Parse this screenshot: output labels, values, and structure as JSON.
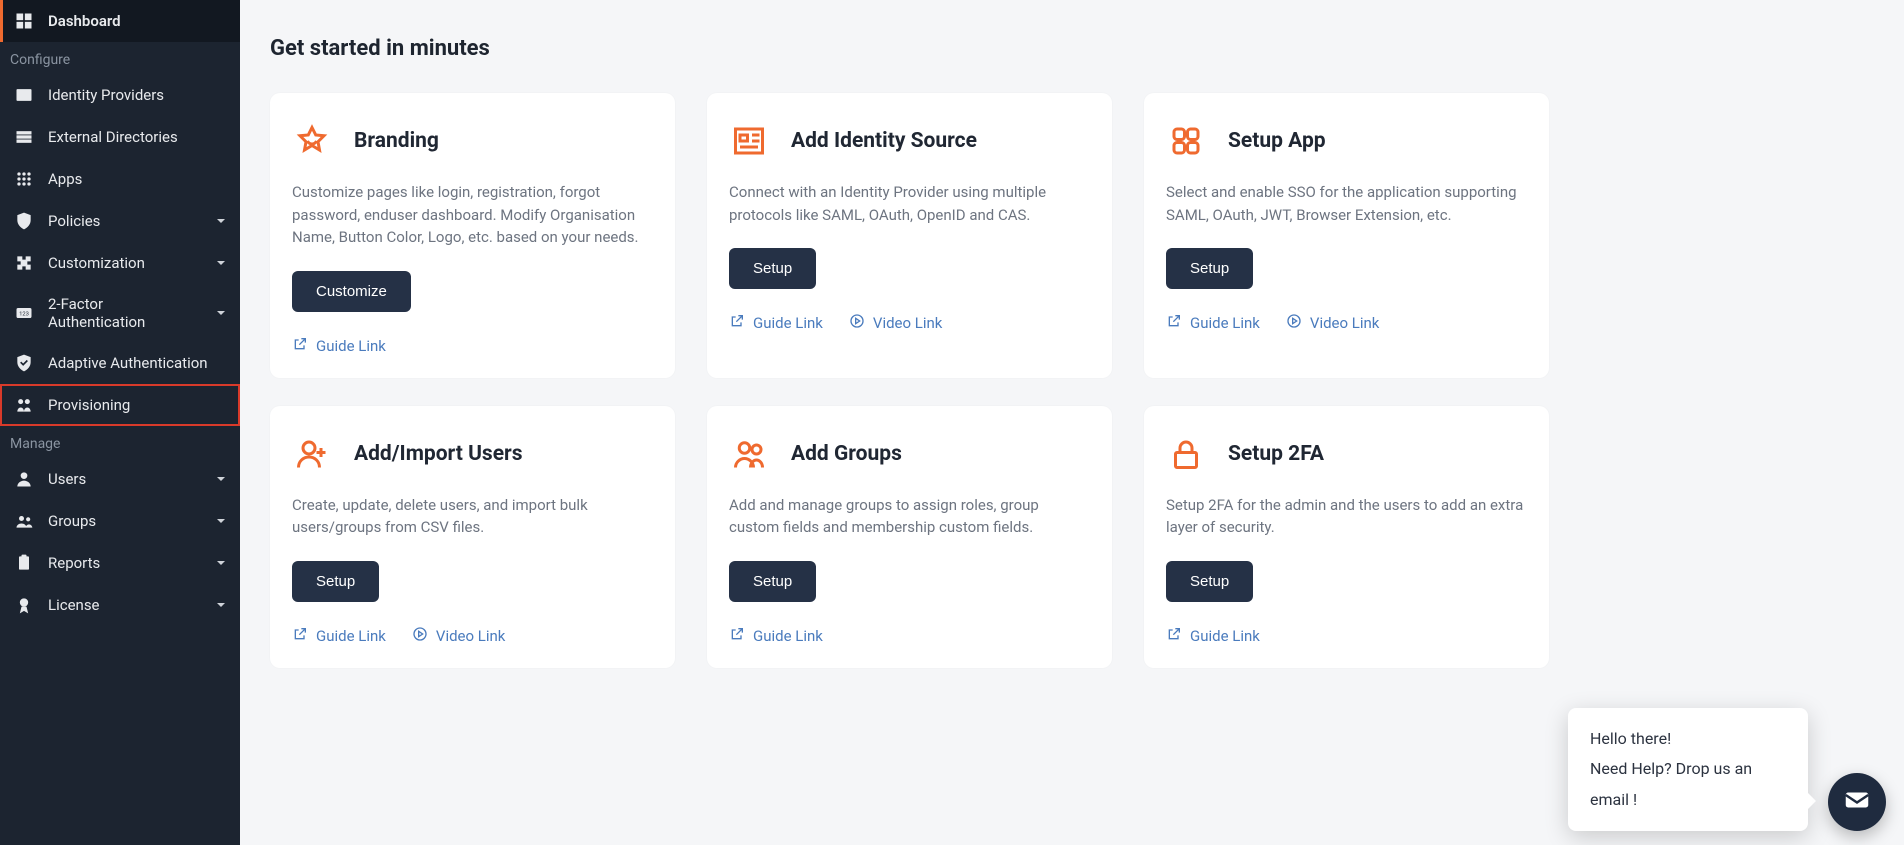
{
  "sidebar": {
    "items": [
      {
        "label": "Dashboard"
      },
      {
        "section": "Configure"
      },
      {
        "label": "Identity Providers"
      },
      {
        "label": "External Directories"
      },
      {
        "label": "Apps"
      },
      {
        "label": "Policies"
      },
      {
        "label": "Customization"
      },
      {
        "label": "2-Factor Authentication"
      },
      {
        "label": "Adaptive Authentication"
      },
      {
        "label": "Provisioning"
      },
      {
        "section": "Manage"
      },
      {
        "label": "Users"
      },
      {
        "label": "Groups"
      },
      {
        "label": "Reports"
      },
      {
        "label": "License"
      }
    ]
  },
  "page": {
    "title": "Get started in minutes"
  },
  "cards": [
    {
      "title": "Branding",
      "desc": "Customize pages like login, registration, forgot password, enduser dashboard. Modify Organisation Name, Button Color, Logo, etc. based on your needs.",
      "button": "Customize",
      "links": [
        {
          "kind": "guide",
          "label": "Guide Link"
        }
      ]
    },
    {
      "title": "Add Identity Source",
      "desc": "Connect with an Identity Provider using multiple protocols like SAML, OAuth, OpenID and CAS.",
      "button": "Setup",
      "links": [
        {
          "kind": "guide",
          "label": "Guide Link"
        },
        {
          "kind": "video",
          "label": "Video Link"
        }
      ]
    },
    {
      "title": "Setup App",
      "desc": "Select and enable SSO for the application supporting SAML, OAuth, JWT, Browser Extension, etc.",
      "button": "Setup",
      "links": [
        {
          "kind": "guide",
          "label": "Guide Link"
        },
        {
          "kind": "video",
          "label": "Video Link"
        }
      ]
    },
    {
      "title": "Add/Import Users",
      "desc": "Create, update, delete users, and import bulk users/groups from CSV files.",
      "button": "Setup",
      "links": [
        {
          "kind": "guide",
          "label": "Guide Link"
        },
        {
          "kind": "video",
          "label": "Video Link"
        }
      ]
    },
    {
      "title": "Add Groups",
      "desc": "Add and manage groups to assign roles, group custom fields and membership custom fields.",
      "button": "Setup",
      "links": [
        {
          "kind": "guide",
          "label": "Guide Link"
        }
      ]
    },
    {
      "title": "Setup 2FA",
      "desc": "Setup 2FA for the admin and the users to add an extra layer of security.",
      "button": "Setup",
      "links": [
        {
          "kind": "guide",
          "label": "Guide Link"
        }
      ]
    }
  ],
  "chat": {
    "greeting": "Hello there!",
    "prompt": "Need Help? Drop us an email !"
  }
}
